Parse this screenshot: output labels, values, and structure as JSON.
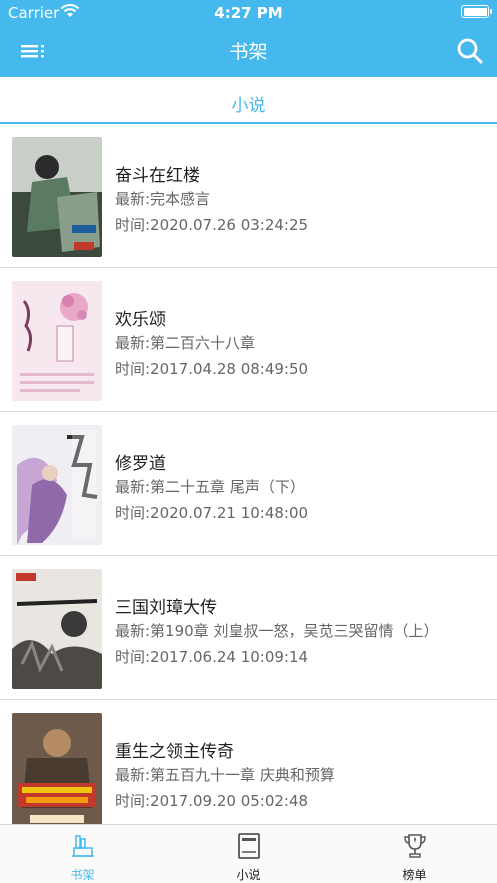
{
  "status_bar": {
    "carrier": "Carrier",
    "time": "4:27 PM"
  },
  "nav": {
    "title": "书架"
  },
  "segment": {
    "label": "小说"
  },
  "books": [
    {
      "title": "奋斗在红楼",
      "latest": "最新:完本感言",
      "time": "时间:2020.07.26 03:24:25"
    },
    {
      "title": "欢乐颂",
      "latest": "最新:第二百六十八章",
      "time": "时间:2017.04.28 08:49:50"
    },
    {
      "title": "修罗道",
      "latest": "最新:第二十五章 尾声（下）",
      "time": "时间:2020.07.21 10:48:00"
    },
    {
      "title": "三国刘璋大传",
      "latest": "最新:第190章 刘皇叔一怒，吴苋三哭留情（上）",
      "time": "时间:2017.06.24 10:09:14"
    },
    {
      "title": "重生之领主传奇",
      "latest": "最新:第五百九十一章 庆典和预算",
      "time": "时间:2017.09.20 05:02:48"
    }
  ],
  "tabs": [
    {
      "label": "书架",
      "icon": "bookshelf-icon",
      "active": true
    },
    {
      "label": "小说",
      "icon": "book-icon",
      "active": false
    },
    {
      "label": "榜单",
      "icon": "trophy-icon",
      "active": false
    }
  ],
  "colors": {
    "accent": "#45b9ee",
    "divider": "#dcdcdc"
  }
}
